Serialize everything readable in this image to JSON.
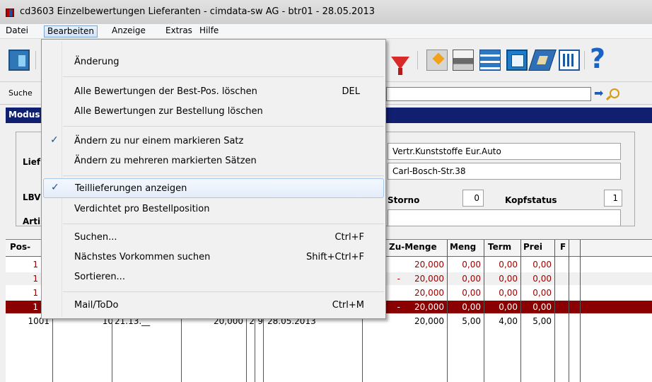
{
  "window": {
    "title": "cd3603 Einzelbewertungen Lieferanten - cimdata-sw AG - btr01 - 28.05.2013"
  },
  "menubar": {
    "items": [
      "Datei",
      "Bearbeiten",
      "Anzeige",
      "Extras",
      "Hilfe"
    ],
    "active": "Bearbeiten"
  },
  "toolbar": {
    "icons": [
      "exit-door",
      "filter-funnel",
      "edit",
      "print",
      "rows-export",
      "windows",
      "tag",
      "grid",
      "help"
    ],
    "help_glyph": "?"
  },
  "search": {
    "label": "Suche",
    "value": ""
  },
  "modus": {
    "label": "Modus"
  },
  "info": {
    "label_lief": "Lief",
    "label_lbv": "LBV",
    "label_arti": "Arti",
    "supplier_name": "Vertr.Kunststoffe Eur.Auto",
    "supplier_street": "Carl-Bosch-Str.38",
    "storno_label": "Storno",
    "storno_value": "0",
    "kopfstatus_label": "Kopfstatus",
    "kopfstatus_value": "1"
  },
  "table": {
    "headers": {
      "pos": "Pos-",
      "zu_menge": "Zu-Menge",
      "meng": "Meng",
      "term": "Term",
      "prei": "Prei",
      "f": "F"
    },
    "rows": [
      {
        "pos": "1",
        "dash": "",
        "zu_menge": "20,000",
        "meng": "0,00",
        "term": "0,00",
        "prei": "0,00",
        "style": "red"
      },
      {
        "pos": "1",
        "dash": "-",
        "zu_menge": "20,000",
        "meng": "0,00",
        "term": "0,00",
        "prei": "0,00",
        "style": "red"
      },
      {
        "pos": "1",
        "dash": "",
        "zu_menge": "20,000",
        "meng": "0,00",
        "term": "0,00",
        "prei": "0,00",
        "style": "red"
      },
      {
        "pos": "1",
        "dash": "-",
        "zu_menge": "20,000",
        "meng": "0,00",
        "term": "0,00",
        "prei": "0,00",
        "style": "selected"
      },
      {
        "pos": "1001",
        "sub": "10",
        "code": "21.13.__",
        "qty": "20,000",
        "a": "2",
        "b": "9",
        "date": "28.05.2013",
        "zu_menge": "20,000",
        "meng": "5,00",
        "term": "4,00",
        "prei": "5,00",
        "style": "normal"
      }
    ]
  },
  "menu": {
    "aenderung": "Änderung",
    "alle_best_pos": "Alle Bewertungen der Best-Pos. löschen",
    "alle_best_pos_key": "DEL",
    "alle_bestellung": "Alle Bewertungen zur Bestellung löschen",
    "aendern_einem": "Ändern zu nur einem markieren Satz",
    "aendern_mehreren": "Ändern zu mehreren markierten Sätzen",
    "teillieferungen": "Teillieferungen anzeigen",
    "verdichtet": "Verdichtet pro Bestellposition",
    "suchen": "Suchen...",
    "suchen_key": "Ctrl+F",
    "naechstes": "Nächstes Vorkommen suchen",
    "naechstes_key": "Shift+Ctrl+F",
    "sortieren": "Sortieren...",
    "mail": "Mail/ToDo",
    "mail_key": "Ctrl+M",
    "check_glyph": "✓"
  },
  "colors": {
    "modus_bar": "#111f70",
    "selected_row": "#8b0000",
    "red_text": "#a00000",
    "menu_highlight_border": "#a8c8ec"
  }
}
